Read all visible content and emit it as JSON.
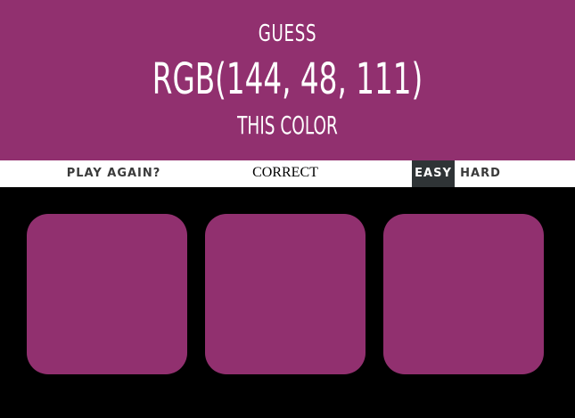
{
  "colors": {
    "target": "#91306F",
    "stripe_bg": "#FFFFFF",
    "active_mode_bg": "#2F3436",
    "page_bg": "#000000"
  },
  "header": {
    "line1": "GUESS",
    "rgb": "RGB(144, 48, 111)",
    "line3": "THIS COLOR"
  },
  "stripe": {
    "reset_label": "PLAY AGAIN?",
    "message": "CORRECT",
    "easy_label": "EASY",
    "hard_label": "HARD",
    "selected_mode": "easy"
  },
  "squares": [
    {
      "color": "#91306F"
    },
    {
      "color": "#91306F"
    },
    {
      "color": "#91306F"
    }
  ]
}
